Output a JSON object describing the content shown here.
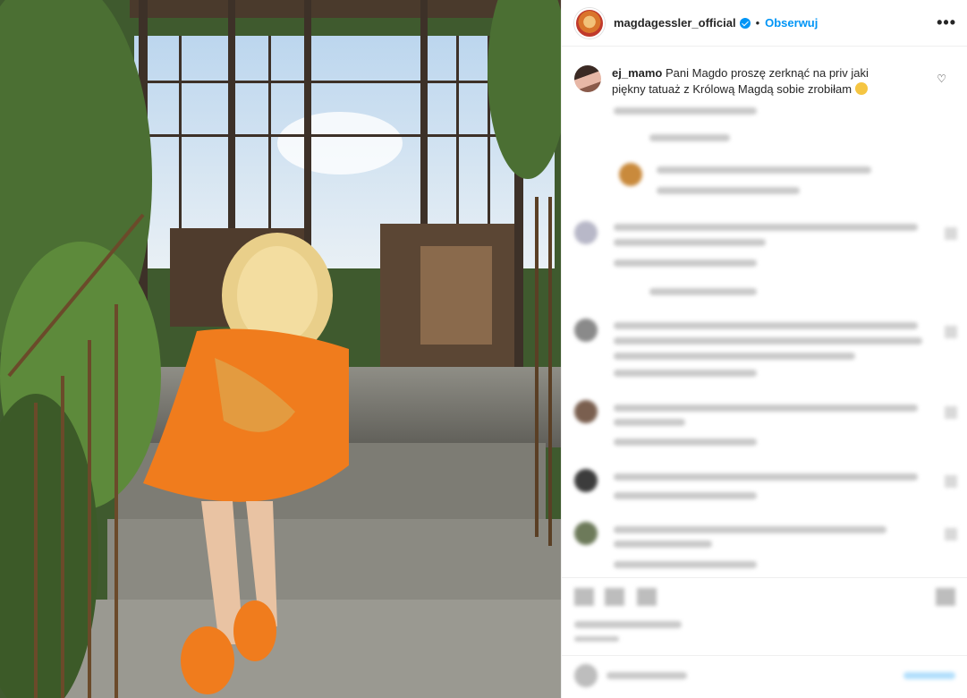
{
  "post": {
    "username": "magdagessler_official",
    "separator": "•",
    "follow_label": "Obserwuj",
    "more_label": "•••"
  },
  "comment": {
    "username": "ej_mamo",
    "text": "Pani Magdo proszę zerknąć na priv jaki piękny tatuaż z Królową Magdą sobie zrobiłam",
    "heart_icon": "heart-outline-icon"
  },
  "colors": {
    "link": "#0095f6",
    "text": "#262626",
    "divider": "#efefef"
  }
}
